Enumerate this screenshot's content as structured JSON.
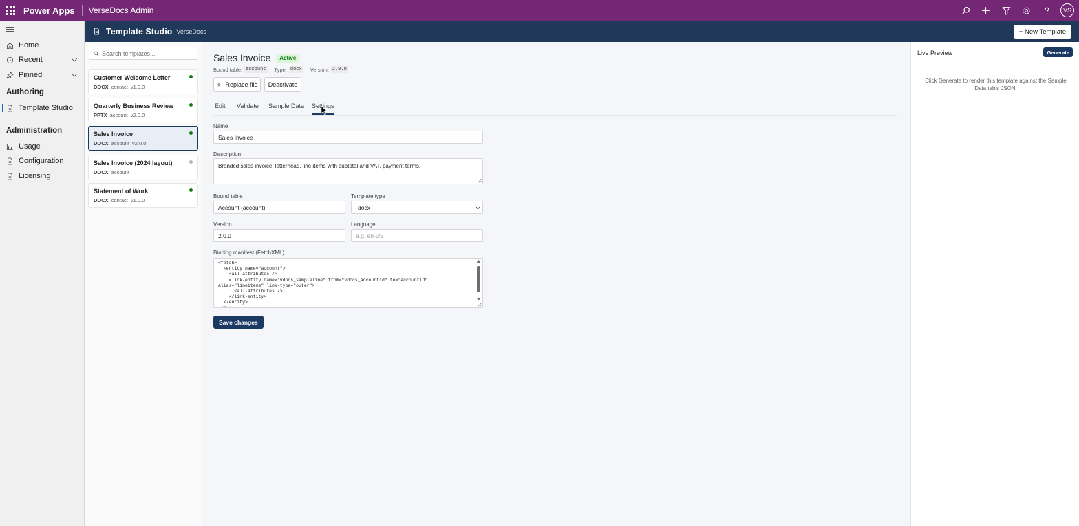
{
  "app": {
    "brand": "Power Apps",
    "environment": "VerseDocs Admin",
    "avatar_initials": "VS",
    "accent": "#742774"
  },
  "topbar_icons": [
    "search-icon",
    "plus-icon",
    "filter-icon",
    "gear-icon",
    "help-icon"
  ],
  "leftnav": {
    "items": [
      {
        "label": "Home",
        "icon": "home-icon"
      },
      {
        "label": "Recent",
        "icon": "clock-icon",
        "expandable": true
      },
      {
        "label": "Pinned",
        "icon": "pin-icon",
        "expandable": true
      }
    ],
    "sections": [
      {
        "title": "Authoring",
        "items": [
          {
            "label": "Template Studio",
            "icon": "document-icon",
            "active": true
          }
        ]
      },
      {
        "title": "Administration",
        "items": [
          {
            "label": "Usage",
            "icon": "chart-icon"
          },
          {
            "label": "Configuration",
            "icon": "document-icon"
          },
          {
            "label": "Licensing",
            "icon": "document-icon"
          }
        ]
      }
    ]
  },
  "header": {
    "title": "Template Studio",
    "subtitle": "VerseDocs",
    "new_template_label": "+ New Template",
    "color": "#20385a"
  },
  "template_list": {
    "search_placeholder": "Search templates...",
    "items": [
      {
        "name": "Customer Welcome Letter",
        "type": "DOCX",
        "table": "contact",
        "version": "v1.0.0",
        "status_color": "#107c10"
      },
      {
        "name": "Quarterly Business Review",
        "type": "PPTX",
        "table": "account",
        "version": "v2.0.0",
        "status_color": "#107c10"
      },
      {
        "name": "Sales Invoice",
        "type": "DOCX",
        "table": "account",
        "version": "v2.0.0",
        "status_color": "#107c10",
        "selected": true
      },
      {
        "name": "Sales Invoice (2024 layout)",
        "type": "DOCX",
        "table": "account",
        "version": "",
        "status_color": "#b3b3b3"
      },
      {
        "name": "Statement of Work",
        "type": "DOCX",
        "table": "contact",
        "version": "v1.0.0",
        "status_color": "#107c10"
      }
    ]
  },
  "editor": {
    "title": "Sales Invoice",
    "status": "Active",
    "meta": {
      "bound_label": "Bound table:",
      "bound_value": "account",
      "type_label": "Type:",
      "type_value": "docx",
      "version_label": "Version:",
      "version_value": "2.0.0"
    },
    "replace_file_label": "Replace file",
    "deactivate_label": "Deactivate",
    "tabs": [
      "Edit",
      "Validate",
      "Sample Data",
      "Settings"
    ],
    "active_tab": "Settings",
    "form": {
      "name_label": "Name",
      "name_value": "Sales Invoice",
      "description_label": "Description",
      "description_value": "Branded sales invoice: letterhead, line items with subtotal and VAT, payment terms.",
      "bound_table_label": "Bound table",
      "bound_table_value": "Account (account)",
      "template_type_label": "Template type",
      "template_type_value": "docx",
      "version_label": "Version",
      "version_value": "2.0.0",
      "language_label": "Language",
      "language_placeholder": "e.g. en-US",
      "manifest_label": "Binding manifest (FetchXML)",
      "manifest_value": "<fetch>\n  <entity name=\"account\">\n    <all-attributes />\n    <link-entity name=\"vdocs_sampleline\" from=\"vdocs_accountid\" to=\"accountid\"\nalias=\"lineitems\" link-type=\"outer\">\n      <all-attributes />\n    </link-entity>\n  </entity>\n</fetch>"
    },
    "save_label": "Save changes"
  },
  "preview": {
    "title": "Live Preview",
    "generate_label": "Generate",
    "hint": "Click Generate to render this template against the Sample Data tab's JSON."
  }
}
